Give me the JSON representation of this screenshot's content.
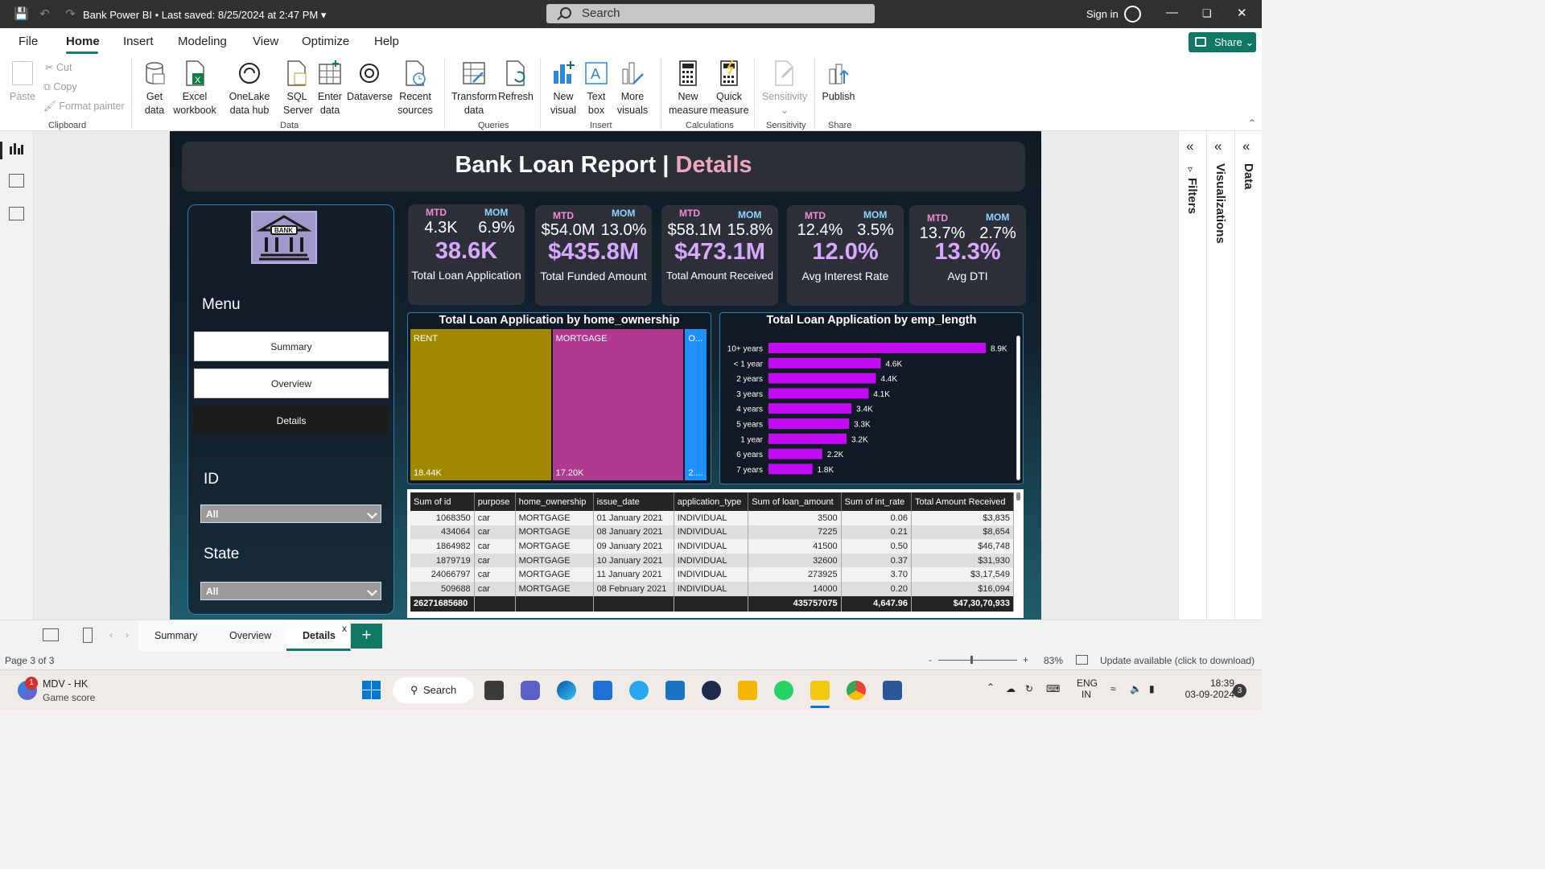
{
  "titlebar": {
    "doc_title": "Bank Power BI",
    "saved": "• Last saved: 8/25/2024 at 2:47 PM",
    "search_placeholder": "Search",
    "signin": "Sign in"
  },
  "menu": {
    "tabs": [
      "File",
      "Home",
      "Insert",
      "Modeling",
      "View",
      "Optimize",
      "Help"
    ],
    "share": "Share"
  },
  "ribbon": {
    "paste": "Paste",
    "cut": "Cut",
    "copy": "Copy",
    "format_painter": "Format painter",
    "clipboard": "Clipboard",
    "get_data": "Get data",
    "excel": "Excel workbook",
    "onelake": "OneLake data hub",
    "sql": "SQL Server",
    "enter_data": "Enter data",
    "dataverse": "Dataverse",
    "recent": "Recent sources",
    "data_group": "Data",
    "transform": "Transform data",
    "refresh": "Refresh",
    "queries": "Queries",
    "new_visual": "New visual",
    "text_box": "Text box",
    "more_visuals": "More visuals",
    "insert": "Insert",
    "new_measure": "New measure",
    "quick_measure": "Quick measure",
    "calculations": "Calculations",
    "sensitivity": "Sensitivity",
    "sensitivity_group": "Sensitivity",
    "publish": "Publish",
    "share_group": "Share"
  },
  "report": {
    "title_main": "Bank Loan Report | ",
    "title_accent": "Details",
    "menu_label": "Menu",
    "nav": [
      "Summary",
      "Overview",
      "Details"
    ],
    "id_label": "ID",
    "id_value": "All",
    "state_label": "State",
    "state_value": "All",
    "kpis": [
      {
        "mtd_label": "MTD",
        "mom_label": "MOM",
        "mtd": "4.3K",
        "mom": "6.9%",
        "value": "38.6K",
        "name": "Total Loan Application"
      },
      {
        "mtd_label": "MTD",
        "mom_label": "MOM",
        "mtd": "$54.0M",
        "mom": "13.0%",
        "value": "$435.8M",
        "name": "Total Funded Amount"
      },
      {
        "mtd_label": "MTD",
        "mom_label": "MOM",
        "mtd": "$58.1M",
        "mom": "15.8%",
        "value": "$473.1M",
        "name": "Total Amount Received"
      },
      {
        "mtd_label": "MTD",
        "mom_label": "MOM",
        "mtd": "12.4%",
        "mom": "3.5%",
        "value": "12.0%",
        "name": "Avg Interest Rate"
      },
      {
        "mtd_label": "MTD",
        "mom_label": "MOM",
        "mtd": "13.7%",
        "mom": "2.7%",
        "value": "13.3%",
        "name": "Avg DTI"
      }
    ]
  },
  "chart_data": [
    {
      "type": "treemap",
      "title": "Total Loan Application by home_ownership",
      "categories": [
        "RENT",
        "MORTGAGE",
        "O..."
      ],
      "value_labels": [
        "18.44K",
        "17.20K",
        "2...."
      ],
      "values": [
        18440,
        17200,
        2990
      ],
      "colors": [
        "#a08800",
        "#b03a8f",
        "#1e90ff"
      ]
    },
    {
      "type": "bar",
      "orientation": "horizontal",
      "title": "Total Loan Application by emp_length",
      "categories": [
        "10+ years",
        "< 1 year",
        "2 years",
        "3 years",
        "4 years",
        "5 years",
        "1 year",
        "6 years",
        "7 years"
      ],
      "values": [
        8900,
        4600,
        4400,
        4100,
        3400,
        3300,
        3200,
        2200,
        1800
      ],
      "value_labels": [
        "8.9K",
        "4.6K",
        "4.4K",
        "4.1K",
        "3.4K",
        "3.3K",
        "3.2K",
        "2.2K",
        "1.8K"
      ],
      "color": "#c20bf5"
    }
  ],
  "table": {
    "columns": [
      "Sum of id",
      "purpose",
      "home_ownership",
      "issue_date",
      "application_type",
      "Sum of loan_amount",
      "Sum of int_rate",
      "Total Amount Received"
    ],
    "rows": [
      [
        "1068350",
        "car",
        "MORTGAGE",
        "01 January 2021",
        "INDIVIDUAL",
        "3500",
        "0.06",
        "$3,835"
      ],
      [
        "434064",
        "car",
        "MORTGAGE",
        "08 January 2021",
        "INDIVIDUAL",
        "7225",
        "0.21",
        "$8,654"
      ],
      [
        "1864982",
        "car",
        "MORTGAGE",
        "09 January 2021",
        "INDIVIDUAL",
        "41500",
        "0.50",
        "$46,748"
      ],
      [
        "1879719",
        "car",
        "MORTGAGE",
        "10 January 2021",
        "INDIVIDUAL",
        "32600",
        "0.37",
        "$31,930"
      ],
      [
        "24066797",
        "car",
        "MORTGAGE",
        "11 January 2021",
        "INDIVIDUAL",
        "273925",
        "3.70",
        "$3,17,549"
      ],
      [
        "509688",
        "car",
        "MORTGAGE",
        "08 February 2021",
        "INDIVIDUAL",
        "14000",
        "0.20",
        "$16,094"
      ]
    ],
    "total": [
      "26271685680",
      "",
      "",
      "",
      "",
      "435757075",
      "4,647.96",
      "$47,30,70,933"
    ]
  },
  "panes": {
    "filters": "Filters",
    "visualizations": "Visualizations",
    "data": "Data"
  },
  "pagetabs": {
    "tabs": [
      "Summary",
      "Overview",
      "Details"
    ],
    "close": "x",
    "add": "+"
  },
  "status": {
    "page": "Page 3 of 3",
    "zoom": "83%",
    "update": "Update available (click to download)"
  },
  "taskbar": {
    "badge": "1",
    "weather_title": "MDV - HK",
    "weather_sub": "Game score",
    "search": "Search",
    "lang1": "ENG",
    "lang2": "IN",
    "time": "18:39",
    "date": "03-09-2024",
    "notif": "3"
  }
}
